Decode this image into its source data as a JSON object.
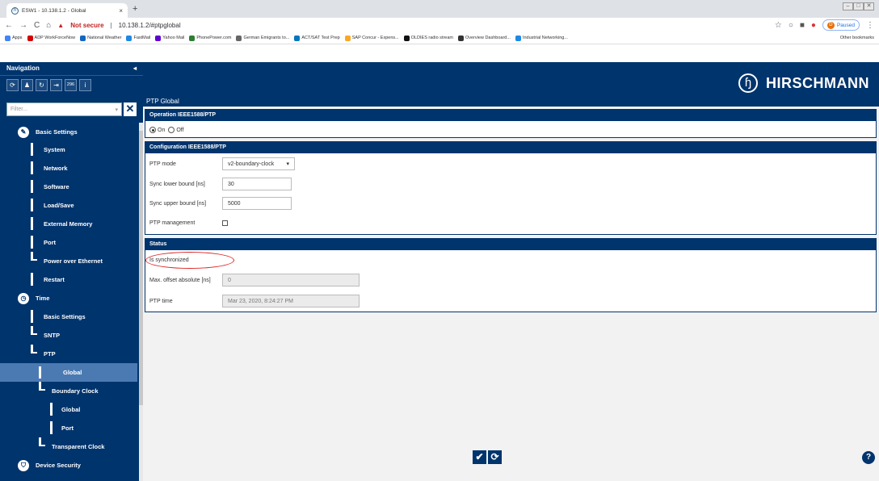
{
  "browser": {
    "tab_title": "ESW1 - 10.138.1.2 - Global",
    "tab_close": "×",
    "new_tab": "+",
    "not_secure": "Not secure",
    "url": "10.138.1.2/#ptpglobal",
    "paused": "Paused",
    "profile_initial": "D",
    "bookmarks": [
      {
        "label": "Apps",
        "color": "#4285f4"
      },
      {
        "label": "ADP WorkForceNow",
        "color": "#d50000"
      },
      {
        "label": "National Weather",
        "color": "#1565c0"
      },
      {
        "label": "FastMail",
        "color": "#1e88e5"
      },
      {
        "label": "Yahoo Mail",
        "color": "#6001d2"
      },
      {
        "label": "PhonePower.com",
        "color": "#2e7d32"
      },
      {
        "label": "German Emigrants to...",
        "color": "#666666"
      },
      {
        "label": "ACT/SAT Test Prep",
        "color": "#0277bd"
      },
      {
        "label": "SAP Concur - Expens...",
        "color": "#f9a825"
      },
      {
        "label": "OLDIES radio stream",
        "color": "#111111"
      },
      {
        "label": "Overview Dashboard...",
        "color": "#333333"
      },
      {
        "label": "Industrial Networking...",
        "color": "#1e88e5"
      }
    ],
    "other_bookmarks": "Other bookmarks"
  },
  "nav": {
    "title": "Navigation",
    "collapse_glyph": "◂",
    "icons": [
      {
        "name": "reload-icon",
        "glyph": "⟳"
      },
      {
        "name": "user-icon",
        "glyph": "♟"
      },
      {
        "name": "refresh-config-icon",
        "glyph": "↻"
      },
      {
        "name": "logout-icon",
        "glyph": "⇥"
      },
      {
        "name": "counter-icon",
        "glyph": "296"
      },
      {
        "name": "info-icon",
        "glyph": "i"
      }
    ],
    "filter_placeholder": "Filter...",
    "filter_dropdown_glyph": "▾",
    "filter_clear_glyph": "✕",
    "items": {
      "basic_settings": "Basic Settings",
      "system": "System",
      "network": "Network",
      "software": "Software",
      "load_save": "Load/Save",
      "external_memory": "External Memory",
      "port": "Port",
      "poe": "Power over Ethernet",
      "restart": "Restart",
      "time": "Time",
      "time_basic": "Basic Settings",
      "sntp": "SNTP",
      "ptp": "PTP",
      "global": "Global",
      "boundary_clock": "Boundary Clock",
      "bc_global": "Global",
      "bc_port": "Port",
      "transparent_clock": "Transparent Clock",
      "device_security": "Device Security"
    }
  },
  "main": {
    "brand": "HIRSCHMANN",
    "brand_glyph": "ɧ",
    "page_title": "PTP Global",
    "operation": {
      "header": "Operation IEEE1588/PTP",
      "on_label": "On",
      "off_label": "Off",
      "selected": "On"
    },
    "configuration": {
      "header": "Configuration IEEE1588/PTP",
      "ptp_mode_label": "PTP mode",
      "ptp_mode_value": "v2-boundary-clock",
      "ptp_mode_caret": "▾",
      "sync_lower_label": "Sync lower bound [ns]",
      "sync_lower_value": "30",
      "sync_upper_label": "Sync upper bound [ns]",
      "sync_upper_value": "5000",
      "ptp_mgmt_label": "PTP management",
      "ptp_mgmt_checked": false
    },
    "status": {
      "header": "Status",
      "is_sync_label": "Is synchronized",
      "max_offset_label": "Max. offset absolute [ns]",
      "max_offset_value": "0",
      "ptp_time_label": "PTP time",
      "ptp_time_value": "Mar 23, 2020, 8:24:27 PM"
    },
    "apply_glyph": "✔",
    "reload_glyph": "⟳",
    "help_glyph": "?"
  }
}
